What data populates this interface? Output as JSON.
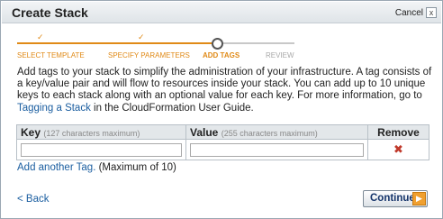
{
  "dialog": {
    "title": "Create Stack",
    "cancel_label": "Cancel",
    "close_glyph": "x"
  },
  "stepper": {
    "steps": [
      {
        "label": "SELECT TEMPLATE",
        "state": "done"
      },
      {
        "label": "SPECIFY PARAMETERS",
        "state": "done"
      },
      {
        "label": "ADD TAGS",
        "state": "current"
      },
      {
        "label": "REVIEW",
        "state": "todo"
      }
    ],
    "check_glyph": "✓",
    "accent_color": "#e08a17"
  },
  "description": {
    "text": "Add tags to your stack to simplify the administration of your infrastructure. A tag consists of a key/value pair and will flow to resources inside your stack. You can add up to 10 unique keys to each stack along with an optional value for each key. For more information, go to ",
    "link_text": "Tagging a Stack",
    "suffix": " in the CloudFormation User Guide."
  },
  "table": {
    "key_header": "Key",
    "key_hint": "(127 characters maximum)",
    "value_header": "Value",
    "value_hint": "(255 characters maximum)",
    "remove_header": "Remove",
    "rows": [
      {
        "key": "",
        "value": ""
      }
    ],
    "remove_icon": "x-remove-icon"
  },
  "add_tag": {
    "link_text": "Add another Tag.",
    "suffix": " (Maximum of 10)"
  },
  "footer": {
    "back_label": "< Back",
    "continue_label": "Continue",
    "continue_arrow": "▶"
  }
}
